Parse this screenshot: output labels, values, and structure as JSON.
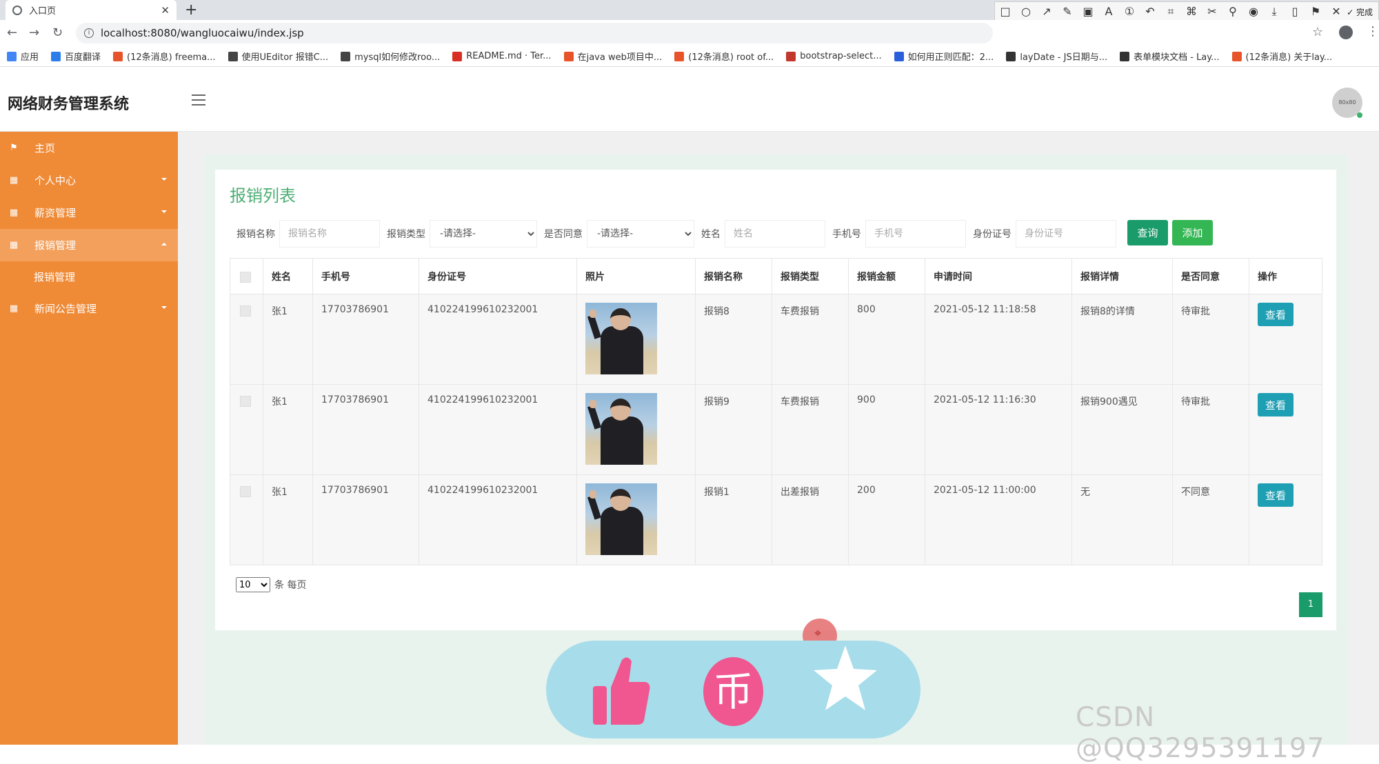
{
  "browser": {
    "tab_title": "入口页",
    "url": "localhost:8080/wangluocaiwu/index.jsp",
    "bookmarks": [
      {
        "label": "应用",
        "color": "#4285f4"
      },
      {
        "label": "百度翻译",
        "color": "#2b7de9"
      },
      {
        "label": "(12条消息) freema...",
        "color": "#e8542a"
      },
      {
        "label": "使用UEditor 报错C...",
        "color": "#444444"
      },
      {
        "label": "mysql如何修改roo...",
        "color": "#444444"
      },
      {
        "label": "README.md · Ter...",
        "color": "#d93025"
      },
      {
        "label": "在java web项目中...",
        "color": "#e8542a"
      },
      {
        "label": "(12条消息) root of...",
        "color": "#e8542a"
      },
      {
        "label": "bootstrap-select...",
        "color": "#c0392b"
      },
      {
        "label": "如何用正则匹配：2...",
        "color": "#2b5fd9"
      },
      {
        "label": "layDate - JS日期与...",
        "color": "#333333"
      },
      {
        "label": "表单模块文档 - Lay...",
        "color": "#333333"
      },
      {
        "label": "(12条消息) 关于lay...",
        "color": "#e8542a"
      }
    ]
  },
  "annotation_toolbar": {
    "font_size": "18",
    "done_label": "完成",
    "current_color": "#e8312f",
    "palette": [
      "#000000",
      "#555555",
      "#8b0000",
      "#c0392b",
      "#e67e22",
      "#27ae60",
      "#2ecc71",
      "#16a085",
      "#ffffff",
      "#aaaaaa",
      "#e84393",
      "#f1c40f",
      "#a3d14a",
      "#3498db",
      "#8e44ad",
      "#00bcd4"
    ]
  },
  "app": {
    "title": "网络财务管理系统",
    "avatar_text": "80x80"
  },
  "sidebar": {
    "items": [
      {
        "label": "主页",
        "icon": "flag-icon",
        "has_caret": false
      },
      {
        "label": "个人中心",
        "icon": "grid-icon",
        "has_caret": true
      },
      {
        "label": "薪资管理",
        "icon": "grid-icon",
        "has_caret": true
      },
      {
        "label": "报销管理",
        "icon": "grid-icon",
        "has_caret": true,
        "active": true
      },
      {
        "label": "新闻公告管理",
        "icon": "grid-icon",
        "has_caret": true
      }
    ],
    "sub_item": "报销管理"
  },
  "page": {
    "title": "报销列表"
  },
  "search": {
    "name_label": "报销名称",
    "name_placeholder": "报销名称",
    "type_label": "报销类型",
    "type_value": "-请选择-",
    "agree_label": "是否同意",
    "agree_value": "-请选择-",
    "person_label": "姓名",
    "person_placeholder": "姓名",
    "phone_label": "手机号",
    "phone_placeholder": "手机号",
    "id_label": "身份证号",
    "id_placeholder": "身份证号",
    "query_button": "查询",
    "add_button": "添加",
    "button_color": "#199b6a",
    "add_color": "#33b653"
  },
  "table": {
    "columns": [
      "姓名",
      "手机号",
      "身份证号",
      "照片",
      "报销名称",
      "报销类型",
      "报销金额",
      "申请时间",
      "报销详情",
      "是否同意",
      "操作"
    ],
    "rows": [
      {
        "name": "张1",
        "phone": "17703786901",
        "id_no": "410224199610232001",
        "title": "报销8",
        "type": "车费报销",
        "amount": "800",
        "time": "2021-05-12 11:18:58",
        "detail": "报销8的详情",
        "status": "待审批",
        "action": "查看"
      },
      {
        "name": "张1",
        "phone": "17703786901",
        "id_no": "410224199610232001",
        "title": "报销9",
        "type": "车费报销",
        "amount": "900",
        "time": "2021-05-12 11:16:30",
        "detail": "报销900遇见",
        "status": "待审批",
        "action": "查看"
      },
      {
        "name": "张1",
        "phone": "17703786901",
        "id_no": "410224199610232001",
        "title": "报销1",
        "type": "出差报销",
        "amount": "200",
        "time": "2021-05-12 11:00:00",
        "detail": "无",
        "status": "不同意",
        "action": "查看"
      }
    ]
  },
  "pager": {
    "page_size": "10",
    "per_page_label": "条 每页",
    "current_page": "1"
  },
  "watermark": "CSDN @QQ3295391197"
}
